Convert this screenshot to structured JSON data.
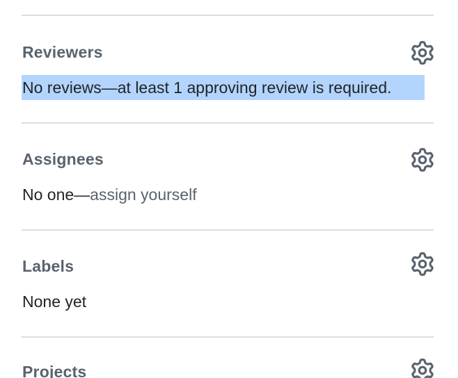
{
  "sections": {
    "reviewers": {
      "title": "Reviewers",
      "value": "No reviews—at least 1 approving review is required."
    },
    "assignees": {
      "title": "Assignees",
      "value_prefix": "No one—",
      "value_link": "assign yourself"
    },
    "labels": {
      "title": "Labels",
      "value": "None yet"
    },
    "projects": {
      "title": "Projects"
    }
  },
  "icons": {
    "settings": "gear-icon"
  },
  "colors": {
    "selection_highlight": "#b3d4fc",
    "heading_text": "#59636e",
    "body_text": "#1f2328",
    "divider": "#d8dee4"
  }
}
